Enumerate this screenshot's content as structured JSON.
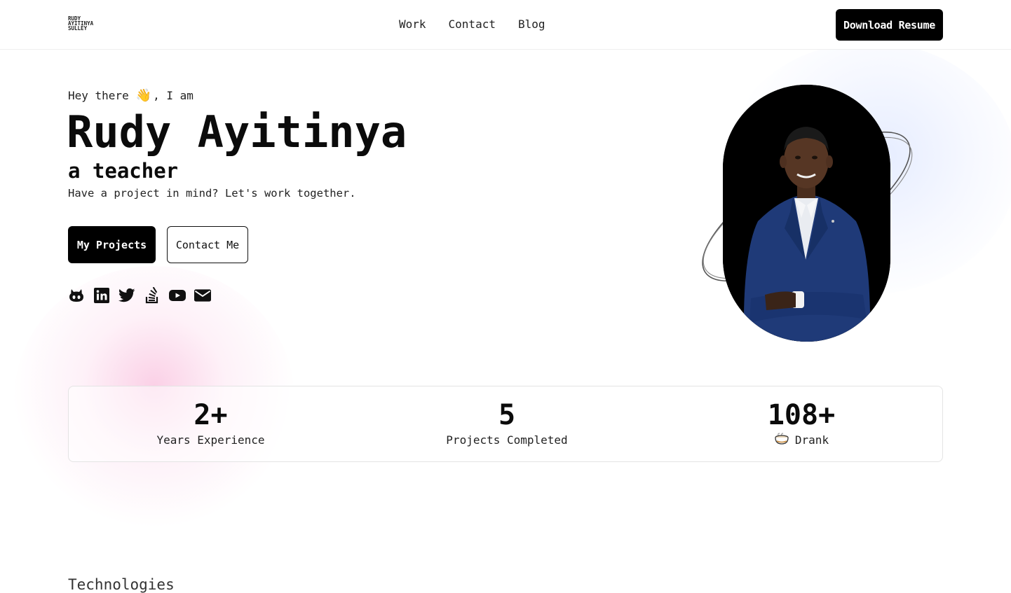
{
  "header": {
    "logo_lines": [
      "RUDY",
      "AYITINYA",
      "SULLEY"
    ],
    "nav": [
      "Work",
      "Contact",
      "Blog"
    ],
    "resume_button": "Download Resume"
  },
  "hero": {
    "greeting_before": "Hey there",
    "greeting_emoji": "👋",
    "greeting_after": ", I am",
    "name": "Rudy Ayitinya",
    "role": "a teacher",
    "tagline": "Have a project in mind? Let's work together.",
    "primary_button": "My Projects",
    "secondary_button": "Contact Me",
    "socials": [
      "github-icon",
      "linkedin-icon",
      "twitter-icon",
      "stackoverflow-icon",
      "youtube-icon",
      "email-icon"
    ]
  },
  "stats": [
    {
      "value": "2+",
      "label": "Years Experience"
    },
    {
      "value": "5",
      "label": "Projects Completed"
    },
    {
      "value": "108+",
      "label": "Drank",
      "icon": "coffee-icon"
    }
  ],
  "sections": {
    "technologies_title": "Technologies"
  },
  "colors": {
    "primary": "#000000",
    "background": "#ffffff",
    "accent_pink_glow": "#f7aad2",
    "accent_blue_glow": "#c8d7ff"
  }
}
